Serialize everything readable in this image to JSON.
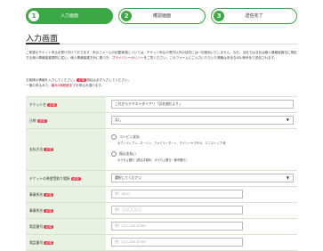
{
  "steps": [
    {
      "num": "1",
      "label": "入力画面"
    },
    {
      "num": "2",
      "label": "確認画面"
    },
    {
      "num": "3",
      "label": "送信完了"
    }
  ],
  "page_title": "入力画面",
  "intro_1a": "ご希望のチケット申込を受け付けております。申込フォームの記載事項については、チケット申込の受付以外の目的には一切使用いたしません。なお、当社では当社",
  "intro_1b": "は個人情報保護法に規定する",
  "intro_1c": "個人情報保護規則",
  "intro_1d": "に従い、個人情報保護方針に基づき、",
  "intro_1e": "プライバシーポリシー",
  "intro_1f": "をご覧ください。このフォームにご入力いただいた情報は安全な",
  "intro_1g": "SSL暗号化",
  "intro_1h": "で送信されます。",
  "intro_2a": "お客様の情報を入力してください。",
  "intro_2b": "必須",
  "intro_2c": "項目は必ず入力してください。",
  "intro_3a": "一度の申込みで、",
  "intro_3b": "最大5席程度まで",
  "intro_3c": "お申込み頂けます。",
  "required_badge": "必須",
  "rows": {
    "ticket": {
      "label": "チケット名",
      "value": "これからテキストダイアリ「浜名湖だより」"
    },
    "count": {
      "label": "日時",
      "value": "なし"
    },
    "payment": {
      "label": "支払方法",
      "opt1": "コンビニ支払",
      "opt1_sub": "セブンイレブン、ローソン、ファミリーマート、デイリーヤマザキ、ミニストップ 他",
      "opt2": "振込支払い",
      "opt2_sub": "ゆうちょ銀行（振込手数料：ゆうちょ銀行・都市銀行）"
    },
    "delivery": {
      "label": "チケットの希望受取り場所",
      "value": "選択してください"
    },
    "name": {
      "label": "事業所名",
      "placeholder": "例）0001"
    },
    "kana": {
      "label": "事業所名",
      "placeholder": "例）〇〇〇〇〇〇"
    },
    "phone": {
      "label": "電話番号",
      "placeholder": "例）012-345-6789"
    },
    "last": {
      "label": "電話番号",
      "placeholder": "例）012-345-6789"
    }
  }
}
